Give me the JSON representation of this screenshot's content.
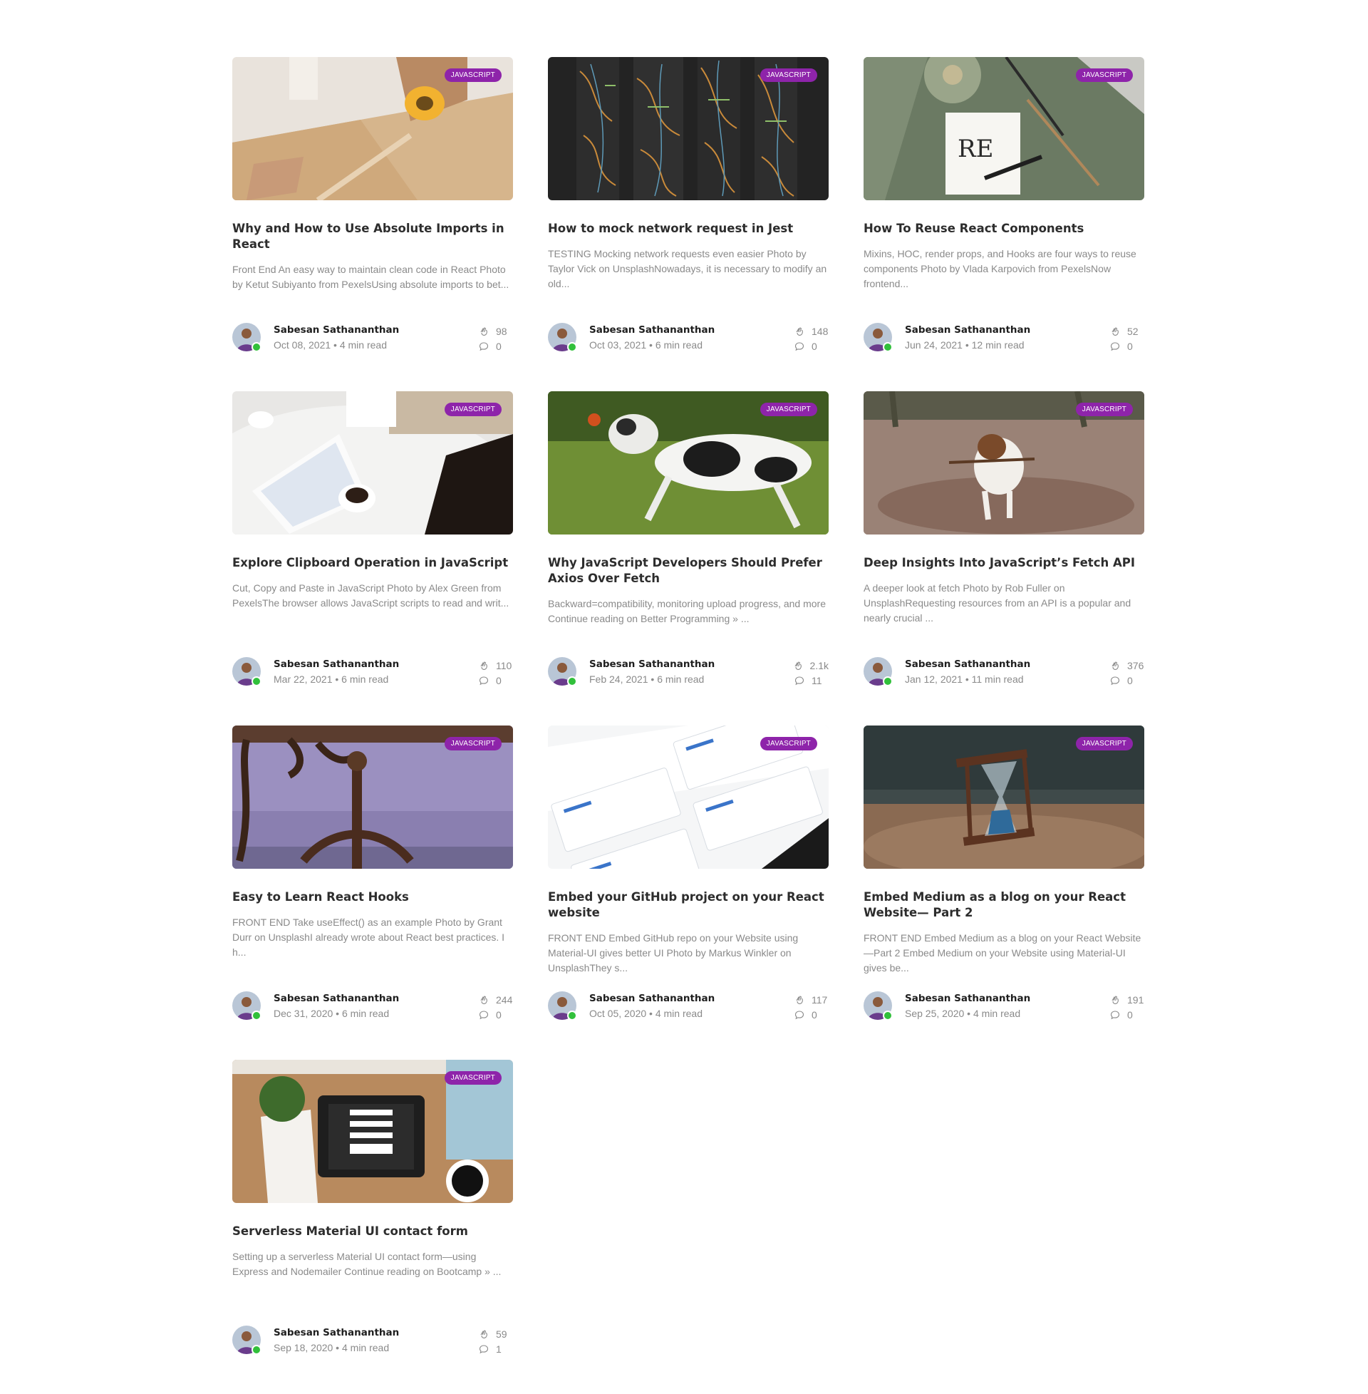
{
  "posts": [
    {
      "category": "JAVASCRIPT",
      "title": "Why and How to Use Absolute Imports in React",
      "excerpt": "Front End An easy way to maintain clean code in React Photo by Ketut Subiyanto from PexelsUsing absolute imports to bet...",
      "author": "Sabesan Sathananthan",
      "date": "Oct 08, 2021 • 4 min read",
      "claps": "98",
      "comments": "0",
      "image": "packing-box-photo"
    },
    {
      "category": "JAVASCRIPT",
      "title": "How to mock network request in Jest",
      "excerpt": "TESTING Mocking network requests even easier Photo by Taylor Vick on UnsplashNowadays, it is necessary to modify an old...",
      "author": "Sabesan Sathananthan",
      "date": "Oct 03, 2021 • 6 min read",
      "claps": "148",
      "comments": "0",
      "image": "server-rack-photo"
    },
    {
      "category": "JAVASCRIPT",
      "title": "How To Reuse React Components",
      "excerpt": "Mixins, HOC, render props, and Hooks are four ways to reuse components Photo by Vlada Karpovich from PexelsNow frontend...",
      "author": "Sabesan Sathananthan",
      "date": "Jun 24, 2021 • 12 min read",
      "claps": "52",
      "comments": "0",
      "image": "reduce-reuse-recycle-photo"
    },
    {
      "category": "JAVASCRIPT",
      "title": "Explore Clipboard Operation in JavaScript",
      "excerpt": "Cut, Copy and Paste in JavaScript Photo by Alex Green from PexelsThe browser allows JavaScript scripts to read and writ...",
      "author": "Sabesan Sathananthan",
      "date": "Mar 22, 2021 • 6 min read",
      "claps": "110",
      "comments": "0",
      "image": "desk-clipboard-photo"
    },
    {
      "category": "JAVASCRIPT",
      "title": "Why JavaScript Developers Should Prefer Axios Over Fetch",
      "excerpt": "Backward=compatibility, monitoring upload progress, and more Continue reading on Better Programming » ...",
      "author": "Sabesan Sathananthan",
      "date": "Feb 24, 2021 • 6 min read",
      "claps": "2.1k",
      "comments": "11",
      "image": "dog-catching-ball-photo"
    },
    {
      "category": "JAVASCRIPT",
      "title": "Deep Insights Into JavaScript’s Fetch API",
      "excerpt": "A deeper look at fetch Photo by Rob Fuller on UnsplashRequesting resources from an API is a popular and nearly crucial ...",
      "author": "Sabesan Sathananthan",
      "date": "Jan 12, 2021 • 11 min read",
      "claps": "376",
      "comments": "0",
      "image": "dog-with-stick-photo"
    },
    {
      "category": "JAVASCRIPT",
      "title": "Easy to Learn React Hooks",
      "excerpt": "FRONT END Take useEffect() as an example Photo by Grant Durr on UnsplashI already wrote about React best practices. I h...",
      "author": "Sabesan Sathananthan",
      "date": "Dec 31, 2020 • 6 min read",
      "claps": "244",
      "comments": "0",
      "image": "anchor-hook-photo"
    },
    {
      "category": "JAVASCRIPT",
      "title": "Embed your GitHub project on your React website",
      "excerpt": "FRONT END Embed GitHub repo on your Website using Material-UI gives better UI Photo by Markus Winkler on UnsplashThey s...",
      "author": "Sabesan Sathananthan",
      "date": "Oct 05, 2020 • 4 min read",
      "claps": "117",
      "comments": "0",
      "image": "github-repos-photo"
    },
    {
      "category": "JAVASCRIPT",
      "title": "Embed Medium as a blog on your React Website— Part 2",
      "excerpt": "FRONT END Embed Medium as a blog on your React Website—Part 2 Embed Medium on your Website using Material-UI gives be...",
      "author": "Sabesan Sathananthan",
      "date": "Sep 25, 2020 • 4 min read",
      "claps": "191",
      "comments": "0",
      "image": "hourglass-photo"
    },
    {
      "category": "JAVASCRIPT",
      "title": "Serverless Material UI contact form",
      "excerpt": "Setting up a serverless Material UI contact form—using Express and Nodemailer Continue reading on Bootcamp » ...",
      "author": "Sabesan Sathananthan",
      "date": "Sep 18, 2020 • 4 min read",
      "claps": "59",
      "comments": "1",
      "image": "tablet-form-photo"
    }
  ],
  "colors": {
    "badge": "#8e24aa",
    "title": "#2d2d2d",
    "muted": "#8a8a8a",
    "online": "#31c03b"
  }
}
